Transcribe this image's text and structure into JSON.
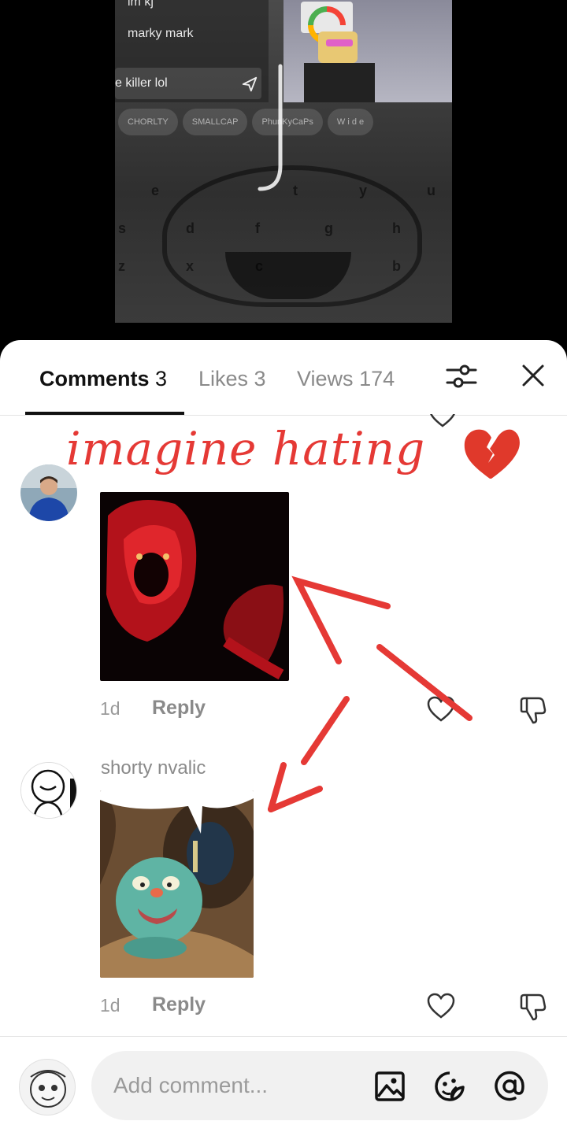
{
  "video": {
    "chat_lines": [
      "im kj",
      "marky mark"
    ],
    "chat_input_text": "e killer lol",
    "keyboard_pills": [
      "CHORLTY",
      "SMALLCAP",
      "PhunKyCaPs",
      "W i d e"
    ],
    "keyboard_keys": [
      "e",
      "t",
      "y",
      "u",
      "s",
      "d",
      "f",
      "g",
      "h",
      "z",
      "x",
      "c",
      "b"
    ]
  },
  "tabs": {
    "comments_label": "Comments",
    "comments_count": "3",
    "likes_label": "Likes",
    "likes_count": "3",
    "views_label": "Views",
    "views_count": "174"
  },
  "overlay": {
    "text": "imagine hating"
  },
  "comments": [
    {
      "username": "",
      "time": "1d",
      "reply_label": "Reply"
    },
    {
      "username": "shorty nvalic",
      "time": "1d",
      "reply_label": "Reply"
    }
  ],
  "input": {
    "placeholder": "Add comment..."
  },
  "icons": [
    "send-icon",
    "filter-icon",
    "close-icon",
    "heart-icon",
    "dislike-icon",
    "image-icon",
    "sticker-icon",
    "mention-icon",
    "broken-heart-icon"
  ],
  "colors": {
    "annotation": "#e53935",
    "text_primary": "#111111",
    "text_secondary": "#8a8a8a"
  }
}
